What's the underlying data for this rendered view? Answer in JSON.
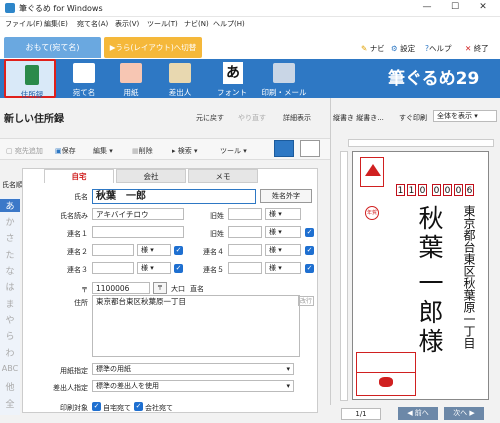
{
  "window": {
    "title": "筆ぐるめ for Windows",
    "minimize": "—",
    "maximize": "☐",
    "close": "✕"
  },
  "menu": [
    "ファイル(F)",
    "編集(E)",
    "宛て名(A)",
    "表示(V)",
    "ツール(T)",
    "ナビ(N)",
    "ヘルプ(H)"
  ],
  "ribbon": {
    "tab_main": "おもて(宛て名)",
    "tab_layout": "▶うら(レイアウト)へ切替",
    "links": {
      "navi": "ナビ",
      "settings": "設定",
      "help": "ヘルプ",
      "exit": "終了"
    }
  },
  "toolbar": {
    "address_book": "住所録",
    "address_name": "宛て名",
    "paper": "用紙",
    "sender": "差出人",
    "font": "フォント",
    "print_mail": "印刷・メール",
    "logo": "筆ぐるめ29"
  },
  "doc": {
    "title": "新しい住所録",
    "undo": "元に戻す",
    "redo": "やり直す",
    "detail": "詳細表示"
  },
  "subtool": {
    "add": "宛先追加",
    "save": "保存",
    "edit": "編集",
    "delete": "削除",
    "search": "検索",
    "tools": "ツール"
  },
  "sort_label": "氏名順",
  "index": [
    "あ",
    "か",
    "さ",
    "た",
    "な",
    "は",
    "ま",
    "や",
    "ら",
    "わ",
    "ABC",
    "他",
    "全"
  ],
  "form": {
    "tabs": [
      "自宅",
      "会社",
      "メモ"
    ],
    "name_label": "氏名",
    "name_value": "秋葉　一郎",
    "gaiji_button": "姓名外字",
    "reading_label": "氏名読み",
    "reading_value": "アキバイチロウ",
    "honorific_label": "旧姓",
    "honorific_value": "様",
    "renmei1": "連名１",
    "renmei2": "連名２",
    "renmei3": "連名３",
    "renmei4": "連名４",
    "renmei5": "連名５",
    "sama": "様",
    "zip_label": "〒",
    "zip_value": "1100006",
    "zip_btn": "〒",
    "oaza": "大口",
    "odoori": "直名",
    "address_label": "住所",
    "address_value": "東京都台東区秋葉原一丁目",
    "line_break": "改行",
    "paper_label": "用紙指定",
    "paper_value": "標準の用紙",
    "sender_label": "差出人指定",
    "sender_value": "標準の差出人を使用",
    "print_target": "印刷対象",
    "home_target": "自宅宛て",
    "company_target": "会社宛て"
  },
  "preview": {
    "mode1": "縦書き 縦書き...",
    "mode2": "すぐ印刷",
    "select": "全体を表示",
    "zip_digits": [
      "1",
      "1",
      "0",
      "0",
      "0",
      "0",
      "6"
    ],
    "address": "東京都台東区秋葉原一丁目",
    "name_line1": "秋葉",
    "name_line2": "一郎様",
    "page": "1/1",
    "prev": "◀ 前へ",
    "next": "次へ ▶"
  }
}
